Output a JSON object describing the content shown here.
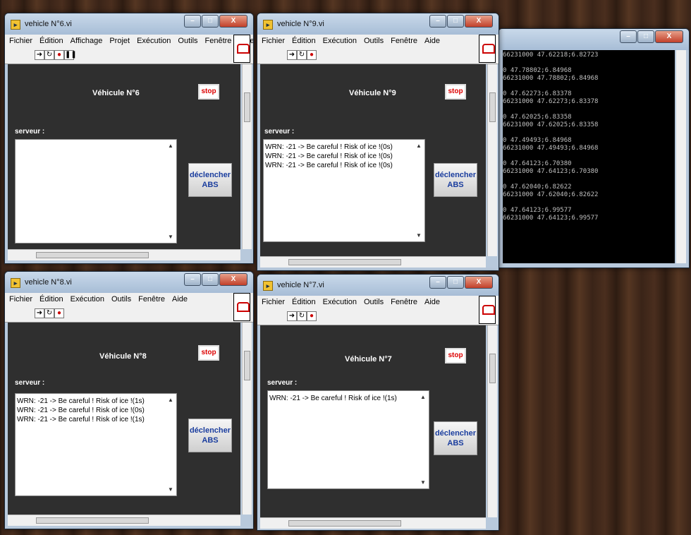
{
  "menus_full": [
    "Fichier",
    "Édition",
    "Affichage",
    "Projet",
    "Exécution",
    "Outils",
    "Fenêtre",
    "Aide"
  ],
  "menus_short": [
    "Fichier",
    "Édition",
    "Exécution",
    "Outils",
    "Fenêtre",
    "Aide"
  ],
  "tool_icons": [
    "run-arrow-icon",
    "run-continuous-icon",
    "abort-icon",
    "pause-icon"
  ],
  "stop_label": "stop",
  "server_label": "serveur :",
  "abs_label_1": "déclencher",
  "abs_label_2": "ABS",
  "windows": {
    "w6": {
      "title": "vehicle N°6.vi",
      "vehicle": "Véhicule N°6",
      "messages": []
    },
    "w9": {
      "title": "vehicle N°9.vi",
      "vehicle": "Véhicule N°9",
      "messages": [
        "WRN: -21 -> Be careful ! Risk of ice !(0s)",
        "WRN: -21 -> Be careful ! Risk of ice !(0s)",
        "WRN: -21 -> Be careful ! Risk of ice !(0s)"
      ]
    },
    "w8": {
      "title": "vehicle N°8.vi",
      "vehicle": "Véhicule N°8",
      "messages": [
        "WRN: -21 -> Be careful ! Risk of ice !(1s)",
        "WRN: -21 -> Be careful ! Risk of ice !(0s)",
        "WRN: -21 -> Be careful ! Risk of ice !(1s)"
      ]
    },
    "w7": {
      "title": "vehicle N°7.vi",
      "vehicle": "Véhicule N°7",
      "messages": [
        "WRN: -21 -> Be careful ! Risk of ice !(1s)"
      ]
    }
  },
  "console": {
    "lines": [
      "66231000 47.62218;6.82723",
      "",
      "0 47.78802;6.84968",
      "66231000 47.78802;6.84968",
      "",
      "0 47.62273;6.83378",
      "66231000 47.62273;6.83378",
      "",
      "0 47.62025;6.83358",
      "66231000 47.62025;6.83358",
      "",
      "0 47.49493;6.84968",
      "66231000 47.49493;6.84968",
      "",
      "0 47.64123;6.70380",
      "66231000 47.64123;6.70380",
      "",
      "0 47.62040;6.82622",
      "66231000 47.62040;6.82622",
      "",
      "0 47.64123;6.99577",
      "66231000 47.64123;6.99577"
    ]
  },
  "window_controls": {
    "minimize": "–",
    "maximize": "□",
    "close": "X"
  }
}
